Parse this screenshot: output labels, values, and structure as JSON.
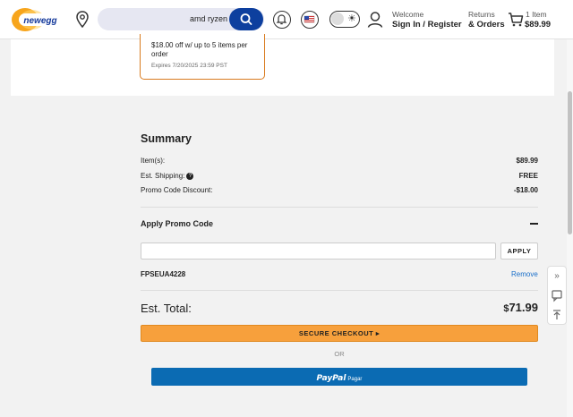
{
  "header": {
    "logo_text": "newegg",
    "search_query": "amd ryzen",
    "welcome": "Welcome",
    "signin": "Sign In / Register",
    "returns": "Returns",
    "orders": "& Orders",
    "cart_count": "1 Item",
    "cart_total": "$89.99"
  },
  "coupon": {
    "description": "$18.00 off w/ up to 5 items per order",
    "expires": "Expires 7/20/2025 23:59 PST",
    "border_color": "#d97b1f"
  },
  "summary": {
    "title": "Summary",
    "rows": [
      {
        "label": "Item(s):",
        "value": "$89.99"
      },
      {
        "label": "Est. Shipping:",
        "value": "FREE"
      },
      {
        "label": "Promo Code Discount:",
        "value": "-$18.00"
      }
    ],
    "promo_title": "Apply Promo Code",
    "promo_input_value": "",
    "apply_label": "APPLY",
    "applied_code": "FPSEUA4228",
    "remove_label": "Remove",
    "total_label": "Est. Total:",
    "total_currency": "$",
    "total_amount": "71.99",
    "checkout_label": "SECURE CHECKOUT ▸",
    "or_label": "OR",
    "paypal_brand": "PayPal",
    "paypal_sub": "Pagar",
    "accent_orange": "#f7a03c",
    "paypal_blue": "#0b6bb3"
  }
}
